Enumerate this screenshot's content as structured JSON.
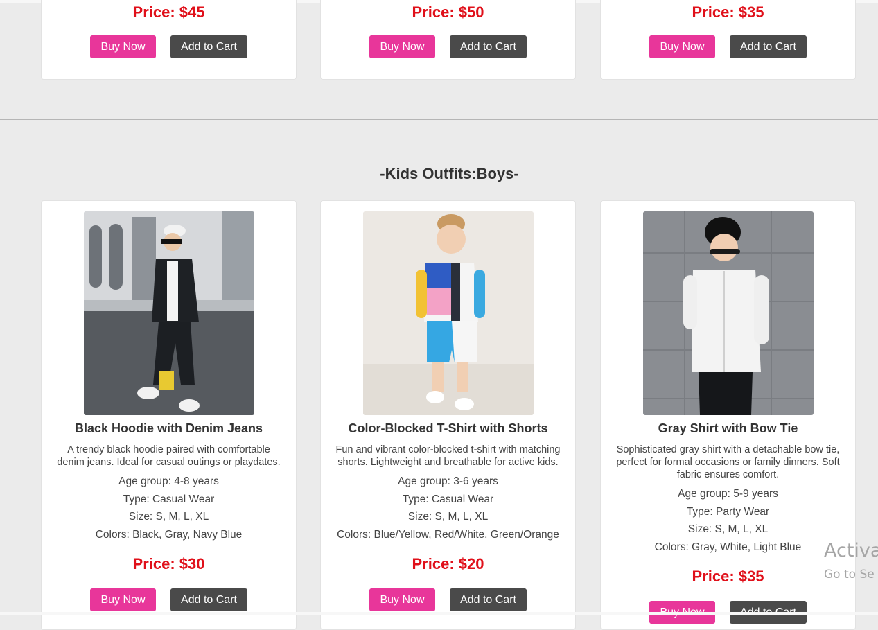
{
  "top_row": [
    {
      "price": "Price: $45",
      "buy_label": "Buy Now",
      "cart_label": "Add to Cart"
    },
    {
      "price": "Price: $50",
      "buy_label": "Buy Now",
      "cart_label": "Add to Cart"
    },
    {
      "price": "Price: $35",
      "buy_label": "Buy Now",
      "cart_label": "Add to Cart"
    }
  ],
  "section": {
    "title": "-Kids Outfits:Boys-"
  },
  "products": [
    {
      "name": "Black Hoodie with Denim Jeans",
      "description": "A trendy black hoodie paired with comfortable denim jeans. Ideal for casual outings or playdates.",
      "age": "Age group: 4-8 years",
      "type": "Type: Casual Wear",
      "size": "Size: S, M, L, XL",
      "colors": "Colors: Black, Gray, Navy Blue",
      "price": "Price: $30",
      "buy_label": "Buy Now",
      "cart_label": "Add to Cart"
    },
    {
      "name": "Color-Blocked T-Shirt with Shorts",
      "description": "Fun and vibrant color-blocked t-shirt with matching shorts. Lightweight and breathable for active kids.",
      "age": "Age group: 3-6 years",
      "type": "Type: Casual Wear",
      "size": "Size: S, M, L, XL",
      "colors": "Colors: Blue/Yellow, Red/White, Green/Orange",
      "price": "Price: $20",
      "buy_label": "Buy Now",
      "cart_label": "Add to Cart"
    },
    {
      "name": "Gray Shirt with Bow Tie",
      "description": "Sophisticated gray shirt with a detachable bow tie, perfect for formal occasions or family dinners. Soft fabric ensures comfort.",
      "age": "Age group: 5-9 years",
      "type": "Type: Party Wear",
      "size": "Size: S, M, L, XL",
      "colors": "Colors: Gray, White, Light Blue",
      "price": "Price: $35",
      "buy_label": "Buy Now",
      "cart_label": "Add to Cart"
    }
  ],
  "watermark": {
    "line1": "Activa",
    "line2": "Go to Se"
  },
  "colors": {
    "price": "#e0101a",
    "buy_button": "#e8369a",
    "cart_button": "#4a4a4a",
    "background": "#ebebeb"
  }
}
